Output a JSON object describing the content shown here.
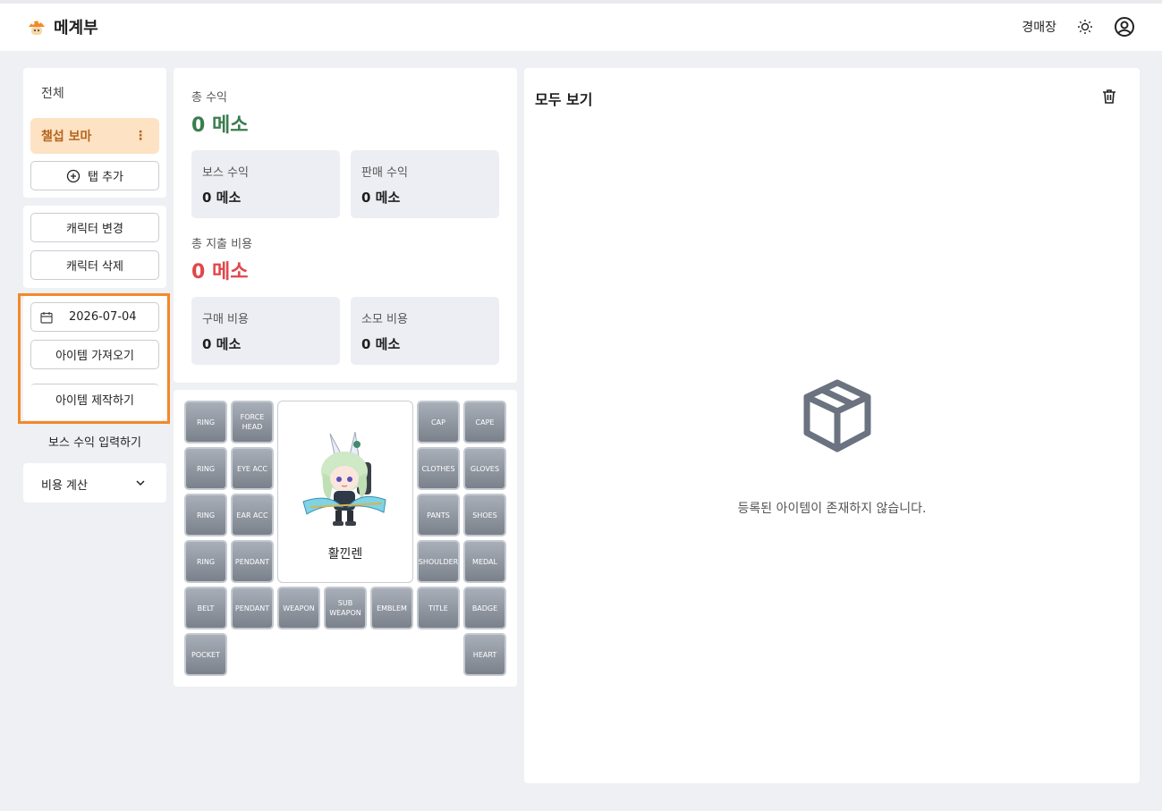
{
  "app": {
    "title": "메계부"
  },
  "nav": {
    "auction_label": "경매장"
  },
  "sidebar": {
    "all_tab": "전체",
    "active_tab": "챌섭 보마",
    "add_tab": "탭 추가",
    "change_character": "캐릭터 변경",
    "delete_character": "캐릭터 삭제",
    "date": "2026-07-04",
    "import_items": "아이템 가져오기",
    "craft_items": "아이템 제작하기",
    "boss_income_input": "보스 수익 입력하기",
    "cost_calc": "비용 계산"
  },
  "summary": {
    "total_income_label": "총 수익",
    "total_income_value": "0 메소",
    "boss_income_label": "보스 수익",
    "boss_income_value": "0 메소",
    "sales_income_label": "판매 수익",
    "sales_income_value": "0 메소",
    "total_expense_label": "총 지출 비용",
    "total_expense_value": "0 메소",
    "purchase_cost_label": "구매 비용",
    "purchase_cost_value": "0 메소",
    "consumable_cost_label": "소모 비용",
    "consumable_cost_value": "0 메소"
  },
  "equipment": {
    "character_name": "활낀렌",
    "slots": {
      "ring1": "RING",
      "force_head": "FORCE HEAD",
      "cap": "CAP",
      "cape": "CAPE",
      "ring2": "RING",
      "eye_acc": "EYE ACC",
      "clothes": "CLOTHES",
      "gloves": "GLOVES",
      "ring3": "RING",
      "ear_acc": "EAR ACC",
      "pants": "PANTS",
      "shoes": "SHOES",
      "ring4": "RING",
      "pendant1": "PENDANT",
      "shoulder": "SHOULDER",
      "medal": "MEDAL",
      "belt": "BELT",
      "pendant2": "PENDANT",
      "weapon": "WEAPON",
      "sub_weapon": "SUB WEAPON",
      "emblem": "EMBLEM",
      "title": "TITLE",
      "badge": "BADGE",
      "pocket": "POCKET",
      "heart": "HEART"
    }
  },
  "items_panel": {
    "title": "모두 보기",
    "empty_message": "등록된 아이템이 존재하지 않습니다."
  },
  "colors": {
    "income": "#3a7d4f",
    "expense": "#e0474c",
    "highlight": "#f5882a",
    "active_tab_bg": "#fde2c4",
    "active_tab_text": "#b5651d"
  }
}
